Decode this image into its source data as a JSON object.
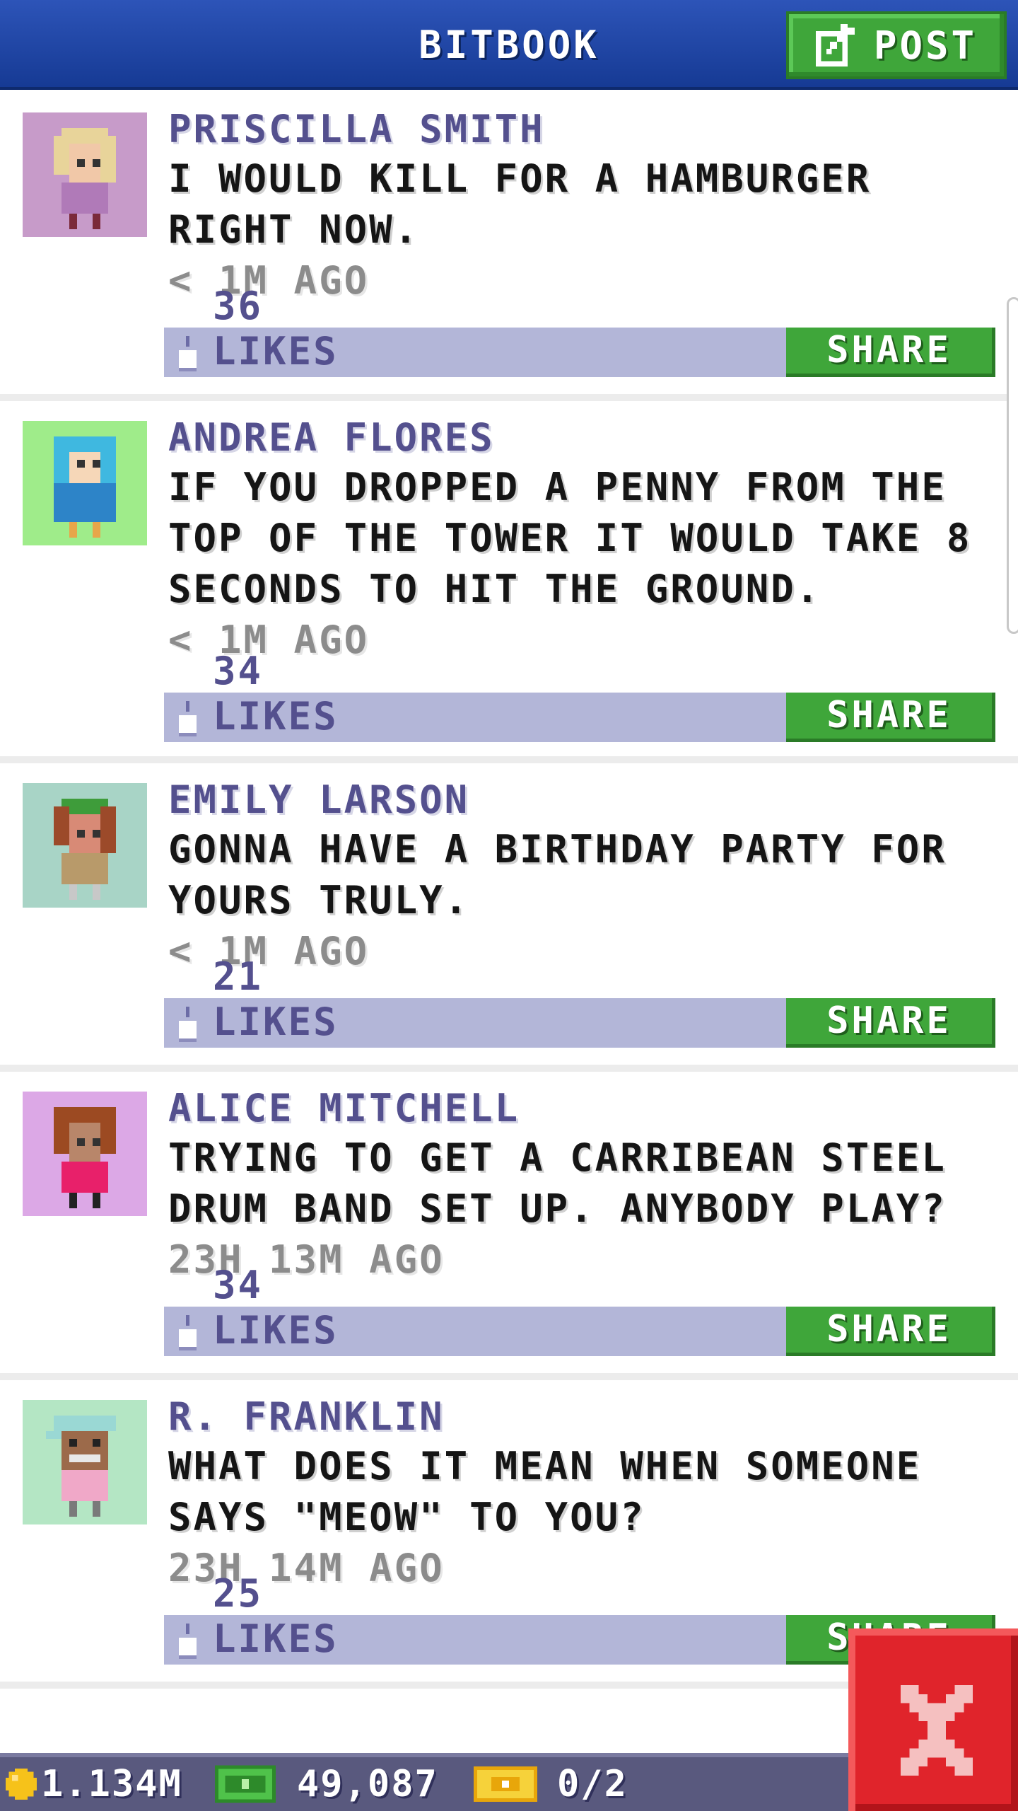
{
  "header": {
    "title": "BITBOOK",
    "post_label": "POST",
    "post_icon": "edit-icon"
  },
  "colors": {
    "header_blue": "#1f45a6",
    "green_button": "#3fa63a",
    "likes_bar": "#b3b6d8",
    "name_text": "#54508e",
    "close_red": "#e0242b",
    "bottom_bar": "#59597e"
  },
  "posts": [
    {
      "name": "PRISCILLA SMITH",
      "message": "I WOULD KILL FOR A HAMBURGER RIGHT NOW.",
      "time": "< 1M AGO",
      "likes": "36 LIKES",
      "share_label": "SHARE",
      "avatar_bg": "#c79bc9"
    },
    {
      "name": "ANDREA FLORES",
      "message": "IF YOU DROPPED A PENNY FROM THE TOP OF THE TOWER IT WOULD TAKE 8 SECONDS TO HIT THE GROUND.",
      "time": "< 1M AGO",
      "likes": "34 LIKES",
      "share_label": "SHARE",
      "avatar_bg": "#9fec8a"
    },
    {
      "name": "EMILY LARSON",
      "message": "GONNA HAVE A BIRTHDAY PARTY FOR YOURS TRULY.",
      "time": "< 1M AGO",
      "likes": "21 LIKES",
      "share_label": "SHARE",
      "avatar_bg": "#a8d4c6"
    },
    {
      "name": "ALICE MITCHELL",
      "message": "TRYING TO GET A CARRIBEAN STEEL DRUM BAND SET UP. ANYBODY PLAY?",
      "time": "23H 13M AGO",
      "likes": "34 LIKES",
      "share_label": "SHARE",
      "avatar_bg": "#dca8e6"
    },
    {
      "name": "R. FRANKLIN",
      "message": "WHAT DOES IT MEAN WHEN SOMEONE SAYS \"MEOW\" TO YOU?",
      "time": "23H 14M AGO",
      "likes": "25 LIKES",
      "share_label": "SHARE",
      "avatar_bg": "#b4e6c4"
    }
  ],
  "status_bar": {
    "coins": "1.134M",
    "cash": "49,087",
    "tickets": "0/2"
  },
  "close_icon": "close-icon"
}
